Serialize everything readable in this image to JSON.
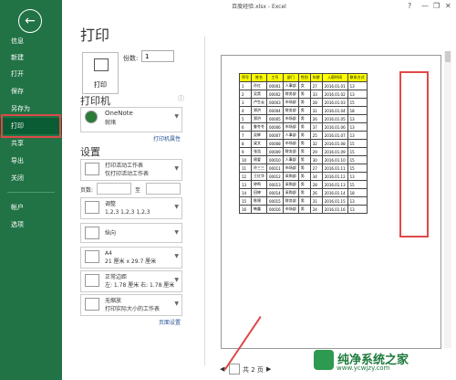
{
  "window": {
    "title": "百度经验.xlsx - Excel",
    "help": "?"
  },
  "sidebar": {
    "items": [
      {
        "label": "信息"
      },
      {
        "label": "新建"
      },
      {
        "label": "打开"
      },
      {
        "label": "保存"
      },
      {
        "label": "另存为"
      },
      {
        "label": "打印"
      },
      {
        "label": "共享"
      },
      {
        "label": "导出"
      },
      {
        "label": "关闭"
      },
      {
        "label": "帐户"
      },
      {
        "label": "选项"
      }
    ]
  },
  "print": {
    "heading": "打印",
    "print_button": "打印",
    "copies_label": "份数:",
    "copies_value": "1"
  },
  "printer": {
    "section": "打印机",
    "info": "ⓘ",
    "name": "OneNote",
    "status": "就绪",
    "properties_link": "打印机属性"
  },
  "settings": {
    "section": "设置",
    "scope": {
      "title": "打印活动工作表",
      "sub": "仅打印活动工作表"
    },
    "pages_label": "页数:",
    "to_label": "至",
    "collate": {
      "title": "调整",
      "sub": "1,2,3    1,2,3    1,2,3"
    },
    "orientation": {
      "title": "纵向"
    },
    "paper": {
      "title": "A4",
      "sub": "21 厘米 x 29.7 厘米"
    },
    "margins": {
      "title": "正常边距",
      "sub": "左: 1.78 厘米  右: 1.78 厘米"
    },
    "scaling": {
      "title": "无缩放",
      "sub": "打印实际大小的工作表"
    },
    "page_setup_link": "页面设置"
  },
  "preview": {
    "headers": [
      "序号",
      "姓名",
      "工号",
      "部门",
      "性别",
      "年龄",
      "入职时间",
      "联系方式"
    ],
    "rows": [
      [
        "1",
        "孙红",
        "00001",
        "人事部",
        "女",
        "27",
        "2016.01.01",
        "13"
      ],
      [
        "2",
        "吴昊",
        "00002",
        "财务部",
        "男",
        "33",
        "2016.01.02",
        "13"
      ],
      [
        "3",
        "卢生云",
        "00003",
        "市场部",
        "男",
        "28",
        "2016.01.03",
        "15"
      ],
      [
        "4",
        "郑洪",
        "00004",
        "财务部",
        "男",
        "31",
        "2016.01.04",
        "18"
      ],
      [
        "5",
        "郑洪",
        "00005",
        "市场部",
        "男",
        "26",
        "2016.01.05",
        "13"
      ],
      [
        "6",
        "鲁冬冬",
        "00006",
        "市场部",
        "男",
        "37",
        "2016.01.06",
        "13"
      ],
      [
        "7",
        "吴辉",
        "00007",
        "人事部",
        "男",
        "25",
        "2016.01.07",
        "13"
      ],
      [
        "8",
        "梁文",
        "00008",
        "市场部",
        "男",
        "32",
        "2016.01.08",
        "15"
      ],
      [
        "9",
        "张浩",
        "00009",
        "财务部",
        "男",
        "29",
        "2016.01.09",
        "15"
      ],
      [
        "10",
        "周爱",
        "00010",
        "人事部",
        "男",
        "30",
        "2016.01.10",
        "15"
      ],
      [
        "11",
        "孙三三",
        "00011",
        "市场部",
        "男",
        "27",
        "2016.01.11",
        "15"
      ],
      [
        "12",
        "王红华",
        "00012",
        "采购部",
        "男",
        "34",
        "2016.01.12",
        "13"
      ],
      [
        "13",
        "钟鸣",
        "00013",
        "采购部",
        "男",
        "28",
        "2016.01.13",
        "15"
      ],
      [
        "14",
        "田婷",
        "00014",
        "采购部",
        "男",
        "26",
        "2016.01.14",
        "18"
      ],
      [
        "15",
        "陈锦",
        "00015",
        "财务部",
        "男",
        "31",
        "2016.01.15",
        "13"
      ],
      [
        "16",
        "韩露",
        "00016",
        "市场部",
        "男",
        "24",
        "2016.01.16",
        "13"
      ]
    ],
    "current_page": "1",
    "of_pages": "共 2 页"
  },
  "watermark": {
    "brand": "纯净系统之家",
    "url": "www.ycwjzy.com"
  },
  "colors": {
    "sidebar": "#217346",
    "highlight": "#e04848",
    "header_fill": "#ffff00"
  }
}
